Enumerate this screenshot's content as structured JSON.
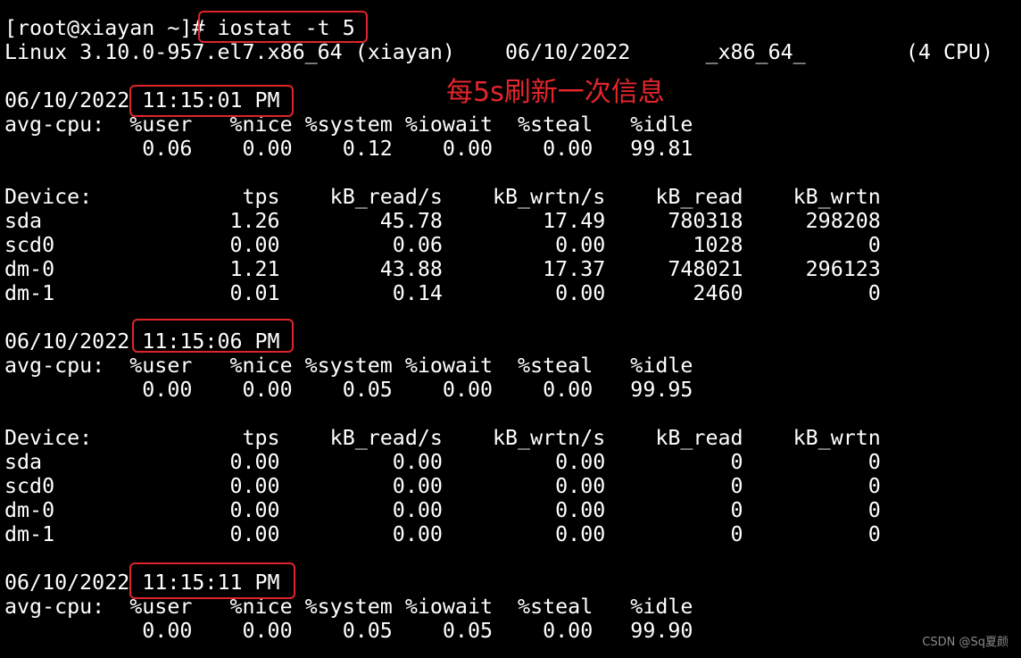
{
  "terminal": {
    "lines": [
      "[root@xiayan ~]# iostat -t 5",
      "Linux 3.10.0-957.el7.x86_64 (xiayan)    06/10/2022      _x86_64_        (4 CPU)",
      "",
      "06/10/2022 11:15:01 PM",
      "avg-cpu:  %user   %nice %system %iowait  %steal   %idle",
      "           0.06    0.00    0.12    0.00    0.00   99.81",
      "",
      "Device:            tps    kB_read/s    kB_wrtn/s    kB_read    kB_wrtn",
      "sda               1.26        45.78        17.49     780318     298208",
      "scd0              0.00         0.06         0.00       1028          0",
      "dm-0              1.21        43.88        17.37     748021     296123",
      "dm-1              0.01         0.14         0.00       2460          0",
      "",
      "06/10/2022 11:15:06 PM",
      "avg-cpu:  %user   %nice %system %iowait  %steal   %idle",
      "           0.00    0.00    0.05    0.00    0.00   99.95",
      "",
      "Device:            tps    kB_read/s    kB_wrtn/s    kB_read    kB_wrtn",
      "sda               0.00         0.00         0.00          0          0",
      "scd0              0.00         0.00         0.00          0          0",
      "dm-0              0.00         0.00         0.00          0          0",
      "dm-1              0.00         0.00         0.00          0          0",
      "",
      "06/10/2022 11:15:11 PM",
      "avg-cpu:  %user   %nice %system %iowait  %steal   %idle",
      "           0.00    0.00    0.05    0.05    0.00   99.90"
    ]
  },
  "annotation": "每5s刷新一次信息",
  "watermark": "CSDN @Sq夏颜",
  "colors": {
    "background": "#000000",
    "text": "#ffffff",
    "highlight": "#e0242b"
  }
}
